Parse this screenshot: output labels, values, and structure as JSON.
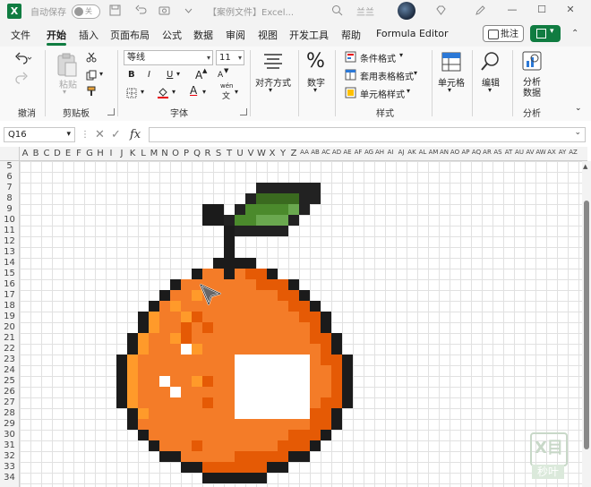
{
  "titlebar": {
    "autosave_label": "自动保存",
    "autosave_state": "关",
    "doc_title": "【案例文件】Excel...",
    "user_name": "兰兰",
    "excel_logo_letter": "X"
  },
  "tabs": [
    "文件",
    "开始",
    "插入",
    "页面布局",
    "公式",
    "数据",
    "审阅",
    "视图",
    "开发工具",
    "帮助",
    "Formula Editor"
  ],
  "active_tab": "开始",
  "comment_button": "批注",
  "ribbon": {
    "undo_group": "撤消",
    "clipboard": {
      "paste": "粘贴",
      "group": "剪贴板"
    },
    "font": {
      "name": "等线",
      "size": "11",
      "bold": "B",
      "italic": "I",
      "underline": "U",
      "font_color_icon": "A",
      "wen": "wén",
      "wen2": "文",
      "group": "字体",
      "grow": "A",
      "shrink": "A"
    },
    "alignment": {
      "label": "对齐方式"
    },
    "number": {
      "label": "数字"
    },
    "styles": {
      "conditional": "条件格式",
      "table": "套用表格格式",
      "cell": "单元格样式",
      "group": "样式"
    },
    "cells": {
      "label": "单元格"
    },
    "editing": {
      "label": "编辑"
    },
    "analysis": {
      "label1": "分析",
      "label2": "数据",
      "group": "分析"
    }
  },
  "formula_bar": {
    "name_box": "Q16",
    "fx": "fx",
    "cancel": "✕",
    "enter": "✓",
    "formula": ""
  },
  "column_headers": [
    "A",
    "B",
    "C",
    "D",
    "E",
    "F",
    "G",
    "H",
    "I",
    "J",
    "K",
    "L",
    "M",
    "N",
    "O",
    "P",
    "Q",
    "R",
    "S",
    "T",
    "U",
    "V",
    "W",
    "X",
    "Y",
    "Z",
    "AA",
    "AB",
    "AC",
    "AD",
    "AE",
    "AF",
    "AG",
    "AH",
    "AI",
    "AJ",
    "AK",
    "AL",
    "AM",
    "AN",
    "AO",
    "AP",
    "AQ",
    "AR",
    "AS",
    "AT",
    "AU",
    "AV",
    "AW",
    "AX",
    "AY",
    "AZ"
  ],
  "row_headers": [
    "5",
    "6",
    "7",
    "8",
    "9",
    "10",
    "11",
    "12",
    "13",
    "14",
    "15",
    "16",
    "17",
    "18",
    "19",
    "20",
    "21",
    "22",
    "23",
    "24",
    "25",
    "26",
    "27",
    "28",
    "29",
    "30",
    "31",
    "32",
    "33",
    "34"
  ],
  "colors": {
    "excel_green": "#107c41",
    "outline": "#1b1b1b",
    "orange": "#f47c28",
    "orange_dark": "#e55a05",
    "orange_light": "#ff9a2a",
    "leaf_dark": "#3a6a1f",
    "leaf_mid": "#4b8a2c",
    "leaf_light": "#6aa84f",
    "leaf_outline": "#222222",
    "white": "#ffffff"
  },
  "watermark": {
    "letters": "X目",
    "text": "秒叶"
  }
}
